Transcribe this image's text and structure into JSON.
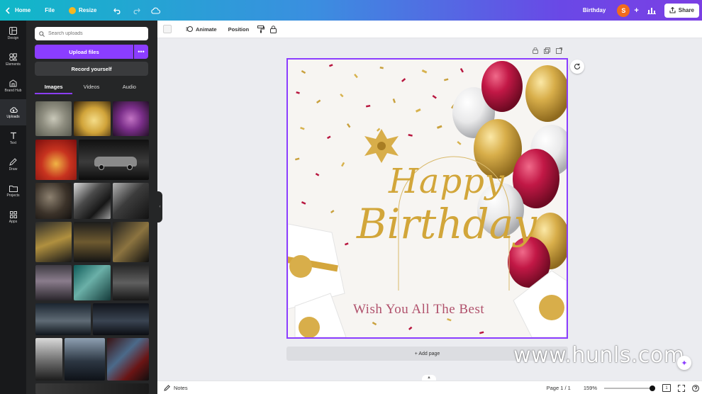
{
  "topbar": {
    "home_label": "Home",
    "file_label": "File",
    "resize_label": "Resize",
    "doc_title": "Birthday",
    "avatar_letter": "S",
    "share_label": "Share",
    "add_symbol": "+"
  },
  "rail": {
    "items": [
      {
        "label": "Design"
      },
      {
        "label": "Elements"
      },
      {
        "label": "Brand Hub"
      },
      {
        "label": "Uploads"
      },
      {
        "label": "Text"
      },
      {
        "label": "Draw"
      },
      {
        "label": "Projects"
      },
      {
        "label": "Apps"
      }
    ]
  },
  "panel": {
    "search_placeholder": "Search uploads",
    "upload_label": "Upload files",
    "more_label": "•••",
    "record_label": "Record yourself",
    "tabs": [
      {
        "label": "Images"
      },
      {
        "label": "Videos"
      },
      {
        "label": "Audio"
      }
    ]
  },
  "toolbar": {
    "animate_label": "Animate",
    "position_label": "Position"
  },
  "design": {
    "happy_text": "Happy",
    "birthday_text": "Birthday",
    "wish_text": "Wish You All The Best"
  },
  "canvas": {
    "add_page_label": "+ Add page",
    "watermark": "www.hunls.com"
  },
  "bottombar": {
    "notes_label": "Notes",
    "page_label": "Page 1 / 1",
    "zoom_label": "159%",
    "page_count": "1",
    "zoom_level_fraction": 0.95
  },
  "colors": {
    "accent": "#8b3dff",
    "gold": "#d2a63a",
    "crimson": "#b0163e"
  }
}
